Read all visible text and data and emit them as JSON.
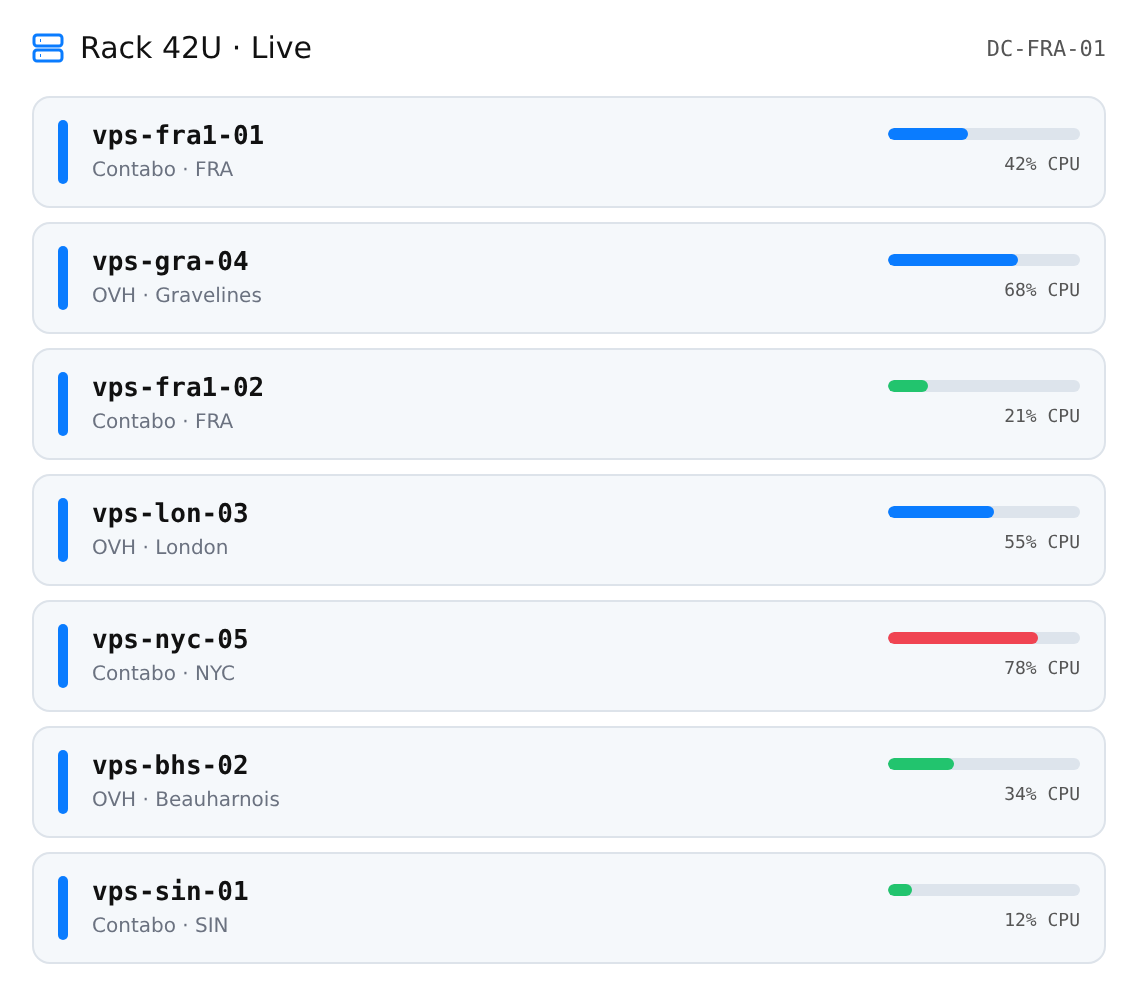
{
  "header": {
    "title": "Rack 42U · Live",
    "location": "DC-FRA-01"
  },
  "servers": [
    {
      "name": "vps-fra1-01",
      "provider": "Contabo · FRA",
      "level": 0.42,
      "color": "#0a7cff",
      "reading": "42% CPU"
    },
    {
      "name": "vps-gra-04",
      "provider": "OVH · Gravelines",
      "level": 0.68,
      "color": "#0a7cff",
      "reading": "68% CPU"
    },
    {
      "name": "vps-fra1-02",
      "provider": "Contabo · FRA",
      "level": 0.21,
      "color": "#22c46e",
      "reading": "21% CPU"
    },
    {
      "name": "vps-lon-03",
      "provider": "OVH · London",
      "level": 0.55,
      "color": "#0a7cff",
      "reading": "55% CPU"
    },
    {
      "name": "vps-nyc-05",
      "provider": "Contabo · NYC",
      "level": 0.78,
      "color": "#f04452",
      "reading": "78% CPU"
    },
    {
      "name": "vps-bhs-02",
      "provider": "OVH · Beauharnois",
      "level": 0.34,
      "color": "#22c46e",
      "reading": "34% CPU"
    },
    {
      "name": "vps-sin-01",
      "provider": "Contabo · SIN",
      "level": 0.12,
      "color": "#22c46e",
      "reading": "12% CPU"
    }
  ]
}
